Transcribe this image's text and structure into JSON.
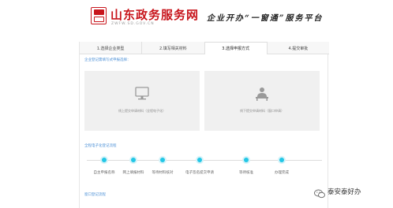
{
  "header": {
    "brand_title": "山东政务服务网",
    "brand_subtitle": "ZWFW.SD.GOV.CN",
    "tagline": "企业开办“一窗通”服务平台"
  },
  "tabs": [
    {
      "label": "1.选择企业类型",
      "active": false
    },
    {
      "label": "2.填写相关材料",
      "active": false
    },
    {
      "label": "3.选择申报方式",
      "active": true
    },
    {
      "label": "4.提交审批",
      "active": false
    }
  ],
  "declaration": {
    "prompt": "企业登记需填写式申报选择：",
    "options": [
      {
        "label": "线上提交申请材料（全程电子化）",
        "icon": "computer-monitor-icon"
      },
      {
        "label": "线下提交申请材料（窗口申请）",
        "icon": "service-counter-icon"
      }
    ]
  },
  "process": {
    "title": "全程电子化登记流程",
    "steps": [
      "自主申报名称",
      "网上填报材料",
      "等待材料核对",
      "电子签名提交申请",
      "等待核准",
      "办理完成"
    ]
  },
  "next_section": {
    "title": "窗口登记流程"
  },
  "watermark": {
    "text": "泰安泰好办"
  },
  "colors": {
    "brand_red": "#c8161d",
    "accent_blue": "#4a8fd6",
    "step_dot": "#23c7e6",
    "card_bg": "#f0f0f0"
  }
}
